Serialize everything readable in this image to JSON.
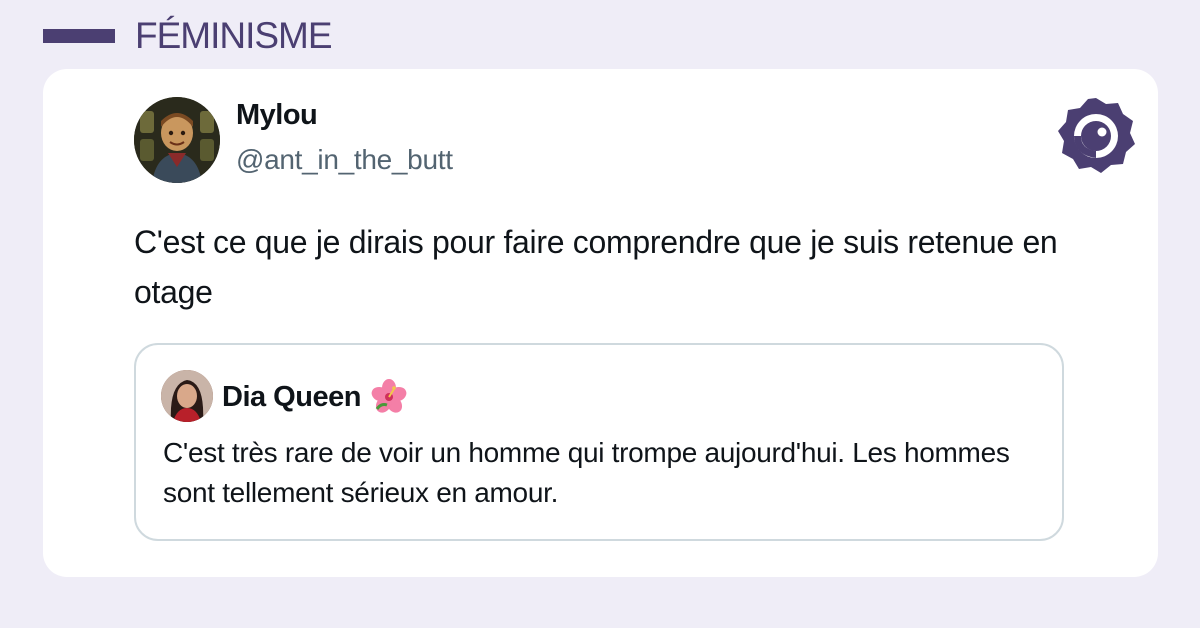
{
  "category": {
    "label": "FÉMINISME"
  },
  "tweet": {
    "author_name": "Mylou",
    "author_handle": "@ant_in_the_butt",
    "text": "C'est ce que je dirais pour faire comprendre que je suis retenue en otage",
    "quoted": {
      "author_name": "Dia Queen",
      "author_emoji": "hibiscus-icon",
      "text": "C'est très rare de voir un homme qui trompe aujourd'hui. Les hommes sont tellement sérieux en amour."
    }
  },
  "colors": {
    "background": "#efedf7",
    "brand": "#4b3f72",
    "card": "#ffffff",
    "handle": "#536471",
    "quote_border": "#cfd9de"
  }
}
